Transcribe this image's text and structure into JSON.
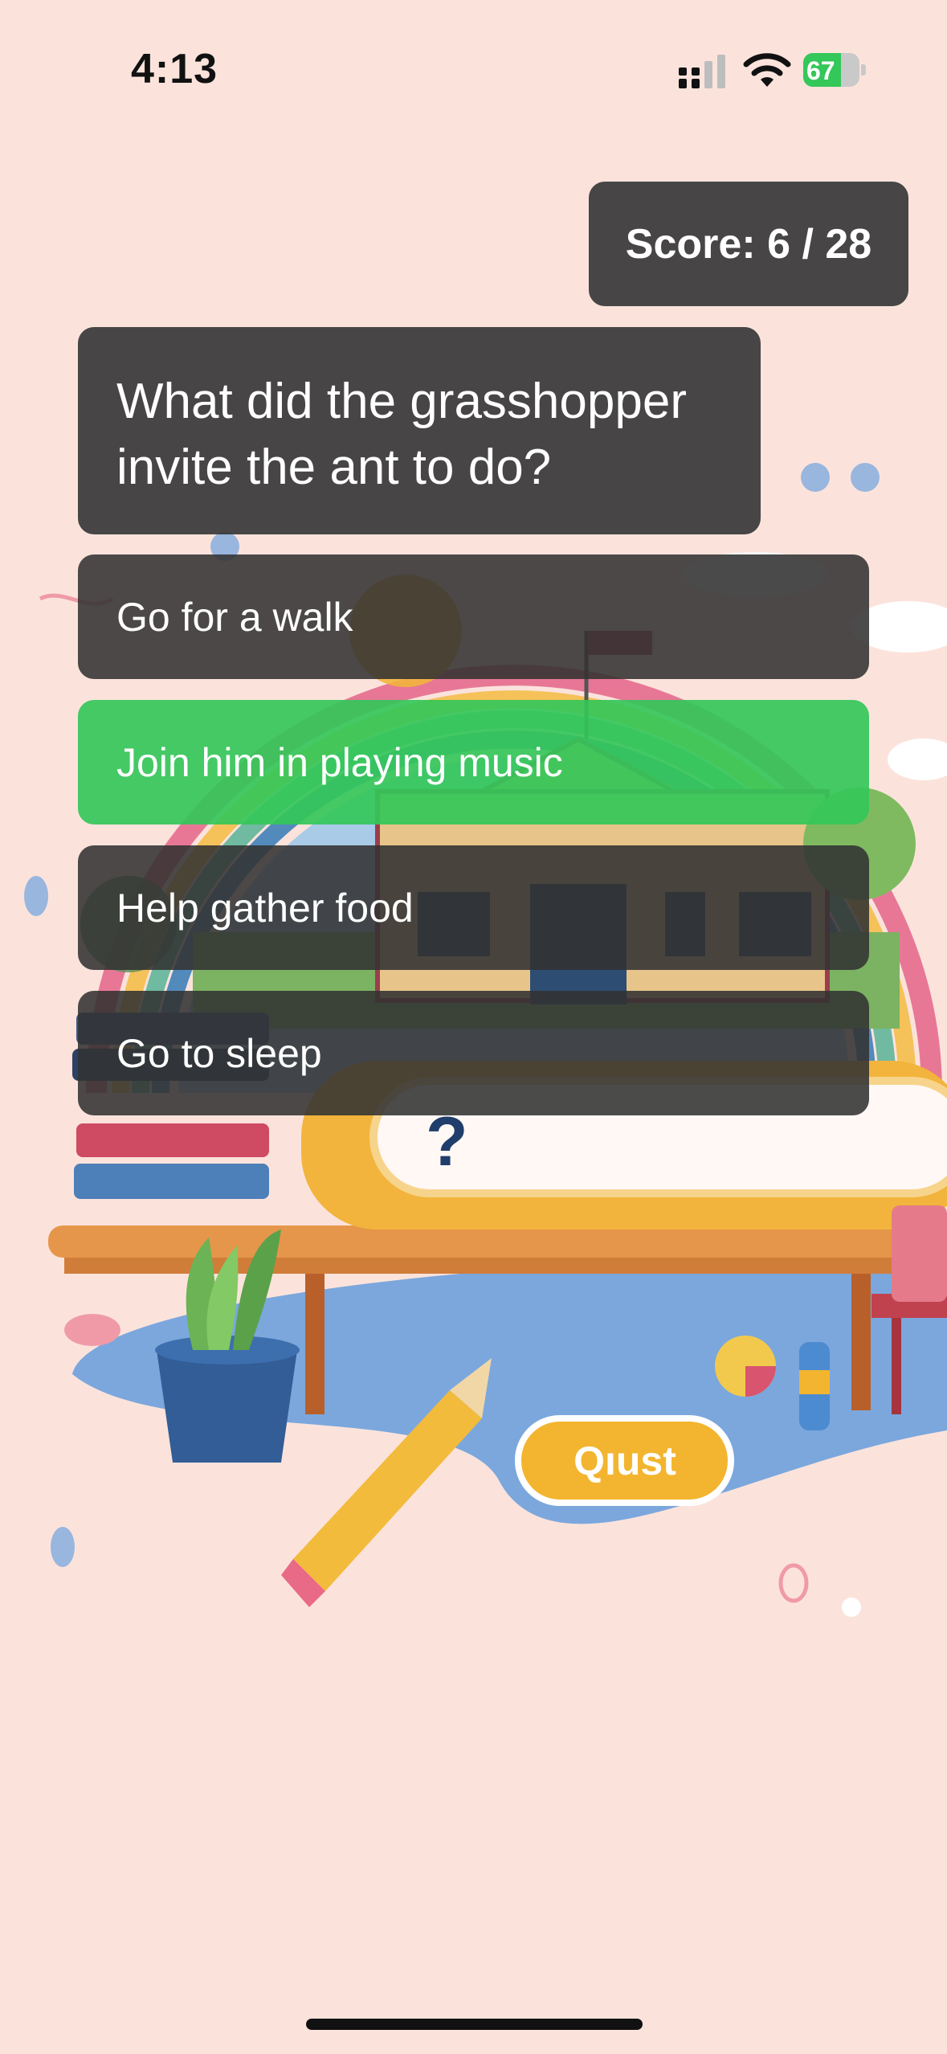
{
  "status_bar": {
    "time": "4:13",
    "battery_percent": "67",
    "battery_level": 0.67,
    "icons": [
      "signal-icon",
      "wifi-icon",
      "battery-charging-icon"
    ]
  },
  "quiz": {
    "score_text": "Score: 6 / 28",
    "question": "What did the grasshopper invite the ant to do?",
    "answers": [
      {
        "label": "Go for a walk",
        "state": "default"
      },
      {
        "label": "Join him in playing music",
        "state": "correct"
      },
      {
        "label": "Help gather food",
        "state": "default"
      },
      {
        "label": "Go to sleep",
        "state": "default"
      }
    ]
  },
  "background": {
    "sign_text": "?",
    "button_text": "Qıust"
  },
  "colors": {
    "page_bg": "#fbe3dc",
    "panel_bg": "#373737",
    "correct": "#34c759"
  }
}
